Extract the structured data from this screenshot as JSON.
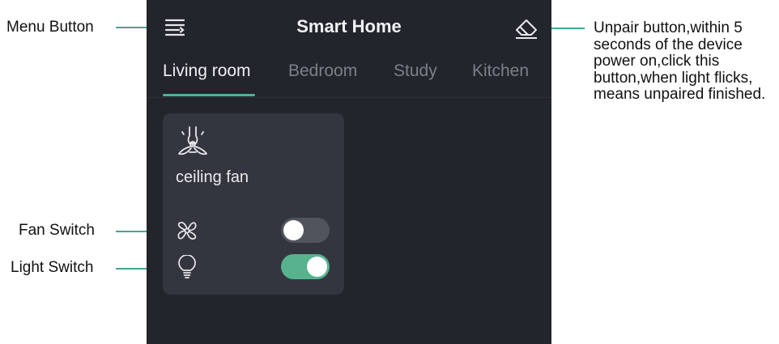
{
  "app": {
    "title": "Smart Home",
    "menu_icon": "menu-icon",
    "unpair_icon": "eraser-icon"
  },
  "tabs": [
    {
      "label": "Living room",
      "active": true
    },
    {
      "label": "Bedroom",
      "active": false
    },
    {
      "label": "Study",
      "active": false
    },
    {
      "label": "Kitchen",
      "active": false
    }
  ],
  "device_card": {
    "icon": "ceiling-fan-icon",
    "name": "ceiling fan",
    "fan_switch": {
      "icon": "fan-blades-icon",
      "state": "off"
    },
    "light_switch": {
      "icon": "light-bulb-icon",
      "state": "on"
    }
  },
  "annotations": {
    "menu_button": "Menu Button",
    "fan_switch": "Fan Switch",
    "light_switch": "Light Switch",
    "unpair_button": "Unpair button,within 5 seconds of the device power on,click this button,when light flicks, means unpaired finished."
  },
  "colors": {
    "background": "#23252c",
    "card": "#34363f",
    "accent": "#4db39a",
    "toggle_on": "#56b38e",
    "toggle_off": "#52545d",
    "leader_line": "#4aa491"
  }
}
